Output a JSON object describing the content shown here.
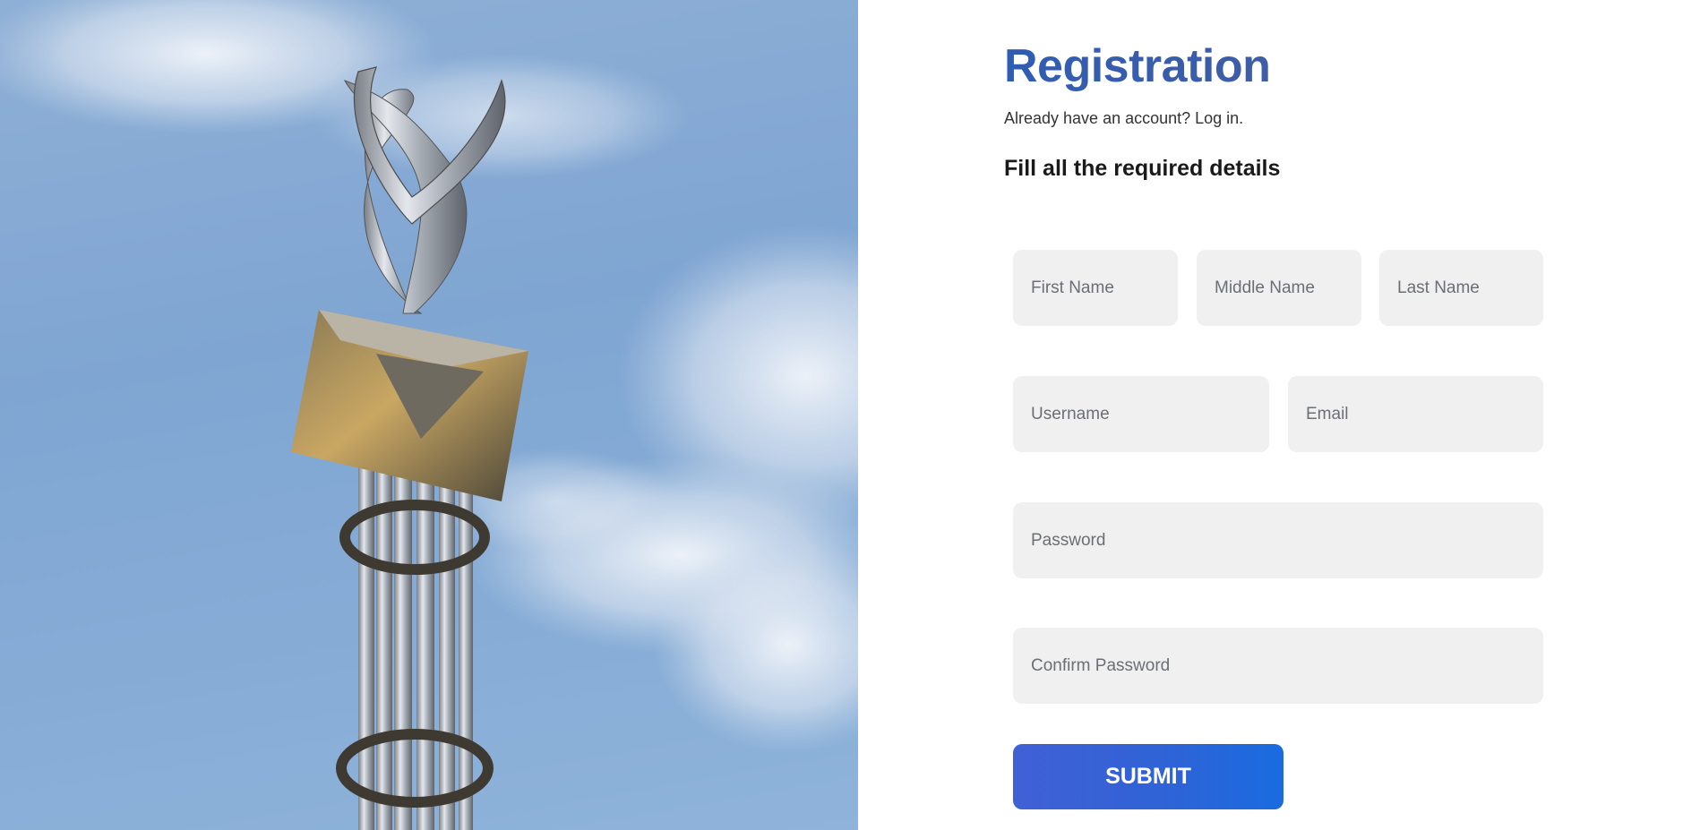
{
  "hero": {
    "image_alt": "Metal sculpture tower against a blue sky with clouds"
  },
  "form": {
    "title": "Registration",
    "login_prompt": "Already have an account? Log in.",
    "section_heading": "Fill all the required details",
    "fields": {
      "first_name": {
        "placeholder": "First Name",
        "value": ""
      },
      "middle_name": {
        "placeholder": "Middle Name",
        "value": ""
      },
      "last_name": {
        "placeholder": "Last Name",
        "value": ""
      },
      "username": {
        "placeholder": "Username",
        "value": ""
      },
      "email": {
        "placeholder": "Email",
        "value": ""
      },
      "password": {
        "placeholder": "Password",
        "value": ""
      },
      "confirm_password": {
        "placeholder": "Confirm Password",
        "value": ""
      }
    },
    "submit_label": "SUBMIT"
  },
  "colors": {
    "title": "#3e5aa8",
    "field_bg": "#f0f0f0",
    "submit_start": "#4160d6",
    "submit_end": "#1a6be0",
    "sky": "#86acd6"
  }
}
